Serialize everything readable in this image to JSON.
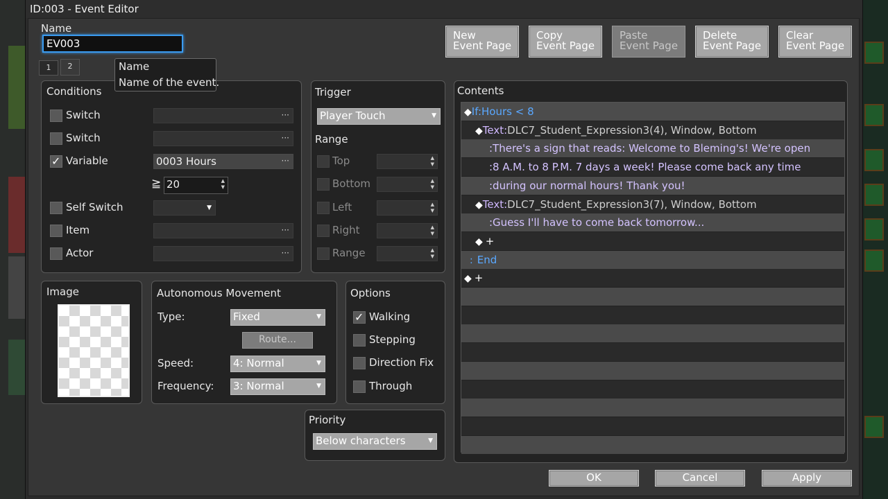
{
  "window": {
    "title": "ID:003 - Event Editor"
  },
  "name_section": {
    "label": "Name",
    "value": "EV003"
  },
  "tooltip": {
    "title": "Name",
    "text": "Name of the event."
  },
  "tabs": [
    "1",
    "2"
  ],
  "toolbar": {
    "new_page": [
      "New",
      "Event Page"
    ],
    "copy_page": [
      "Copy",
      "Event Page"
    ],
    "paste_page": [
      "Paste",
      "Event Page"
    ],
    "delete_page": [
      "Delete",
      "Event Page"
    ],
    "clear_page": [
      "Clear",
      "Event Page"
    ]
  },
  "conditions": {
    "title": "Conditions",
    "switch1": {
      "label": "Switch",
      "value": "",
      "checked": false
    },
    "switch2": {
      "label": "Switch",
      "value": "",
      "checked": false
    },
    "variable": {
      "label": "Variable",
      "value": "0003 Hours",
      "checked": true,
      "operator": "≧",
      "compare": "20"
    },
    "self_switch": {
      "label": "Self Switch",
      "value": "",
      "checked": false
    },
    "item": {
      "label": "Item",
      "value": "",
      "checked": false
    },
    "actor": {
      "label": "Actor",
      "value": "",
      "checked": false
    }
  },
  "trigger": {
    "title": "Trigger",
    "value": "Player Touch",
    "range_title": "Range",
    "range_items": [
      "Top",
      "Bottom",
      "Left",
      "Right",
      "Range"
    ]
  },
  "contents": {
    "title": "Contents",
    "lines": [
      {
        "indent": 0,
        "prefix": "◆",
        "cmd": "If:",
        "rest": "Hours < 8",
        "style": "if"
      },
      {
        "indent": 1,
        "prefix": "◆",
        "cmd": "Text:",
        "rest": "DLC7_Student_Expression3(4), Window, Bottom",
        "style": "text"
      },
      {
        "indent": 2,
        "prefix": "",
        "cmd": "",
        "rest": ":There's a sign that reads: Welcome to Bleming's! We're open",
        "style": "msg"
      },
      {
        "indent": 2,
        "prefix": "",
        "cmd": "",
        "rest": ":8 A.M. to 8 P.M. 7 days a week! Please come back any time",
        "style": "msg"
      },
      {
        "indent": 2,
        "prefix": "",
        "cmd": "",
        "rest": ":during our normal hours! Thank you!",
        "style": "msg"
      },
      {
        "indent": 1,
        "prefix": "◆",
        "cmd": "Text:",
        "rest": "DLC7_Student_Expression3(7), Window, Bottom",
        "style": "text"
      },
      {
        "indent": 2,
        "prefix": "",
        "cmd": "",
        "rest": ":Guess I'll have to come back tomorrow...",
        "style": "msg"
      },
      {
        "indent": 1,
        "prefix": "◆",
        "cmd": "",
        "rest": "+",
        "style": "plain"
      },
      {
        "indent": 0,
        "prefix": ":",
        "cmd": "",
        "rest": "End",
        "style": "end"
      },
      {
        "indent": 0,
        "prefix": "◆",
        "cmd": "",
        "rest": "+",
        "style": "plain"
      }
    ],
    "empty_rows": 9
  },
  "image": {
    "title": "Image"
  },
  "movement": {
    "title": "Autonomous Movement",
    "type_label": "Type:",
    "type_value": "Fixed",
    "route_label": "Route...",
    "speed_label": "Speed:",
    "speed_value": "4: Normal",
    "freq_label": "Frequency:",
    "freq_value": "3: Normal"
  },
  "options": {
    "title": "Options",
    "walking": {
      "label": "Walking",
      "checked": true
    },
    "stepping": {
      "label": "Stepping",
      "checked": false
    },
    "direction_fix": {
      "label": "Direction Fix",
      "checked": false
    },
    "through": {
      "label": "Through",
      "checked": false
    }
  },
  "priority": {
    "title": "Priority",
    "value": "Below characters"
  },
  "footer": {
    "ok": "OK",
    "cancel": "Cancel",
    "apply": "Apply"
  },
  "colors": {
    "accent": "#3a9bef",
    "if_blue": "#5aa8ff",
    "message_lavender": "#d4c3ff"
  }
}
